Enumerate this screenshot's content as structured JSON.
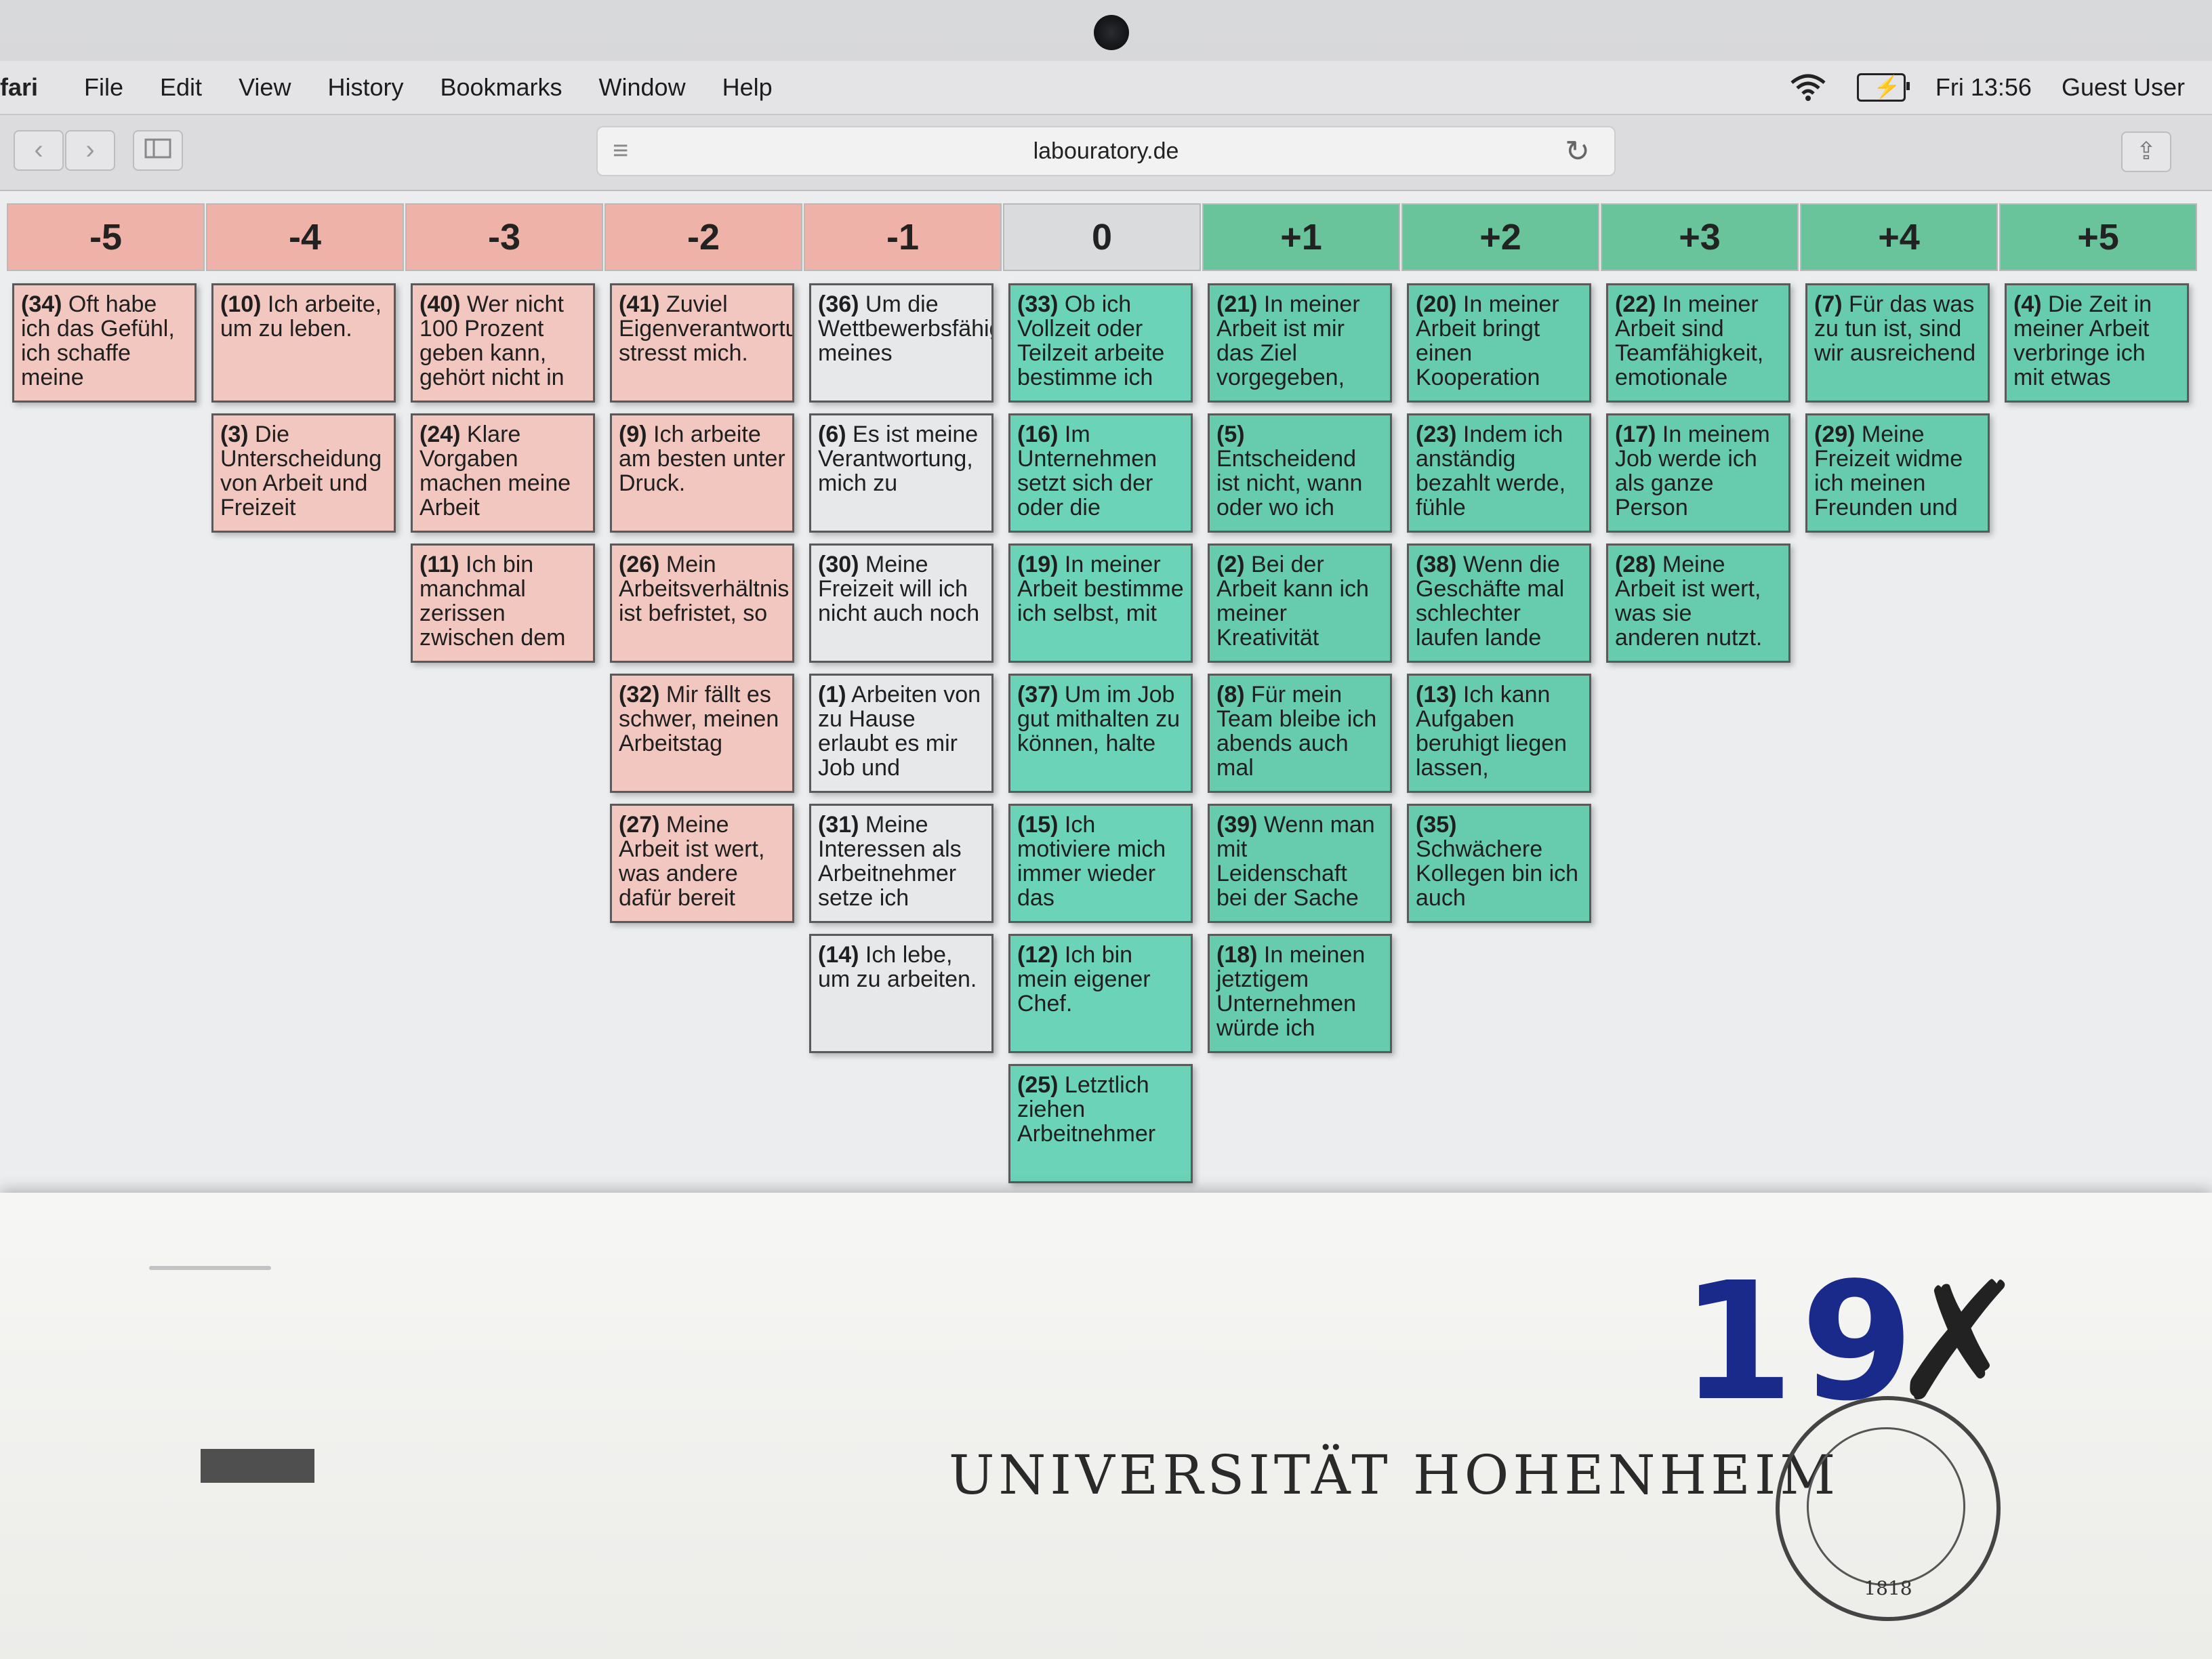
{
  "menubar": {
    "app": "fari",
    "items": [
      "File",
      "Edit",
      "View",
      "History",
      "Bookmarks",
      "Window",
      "Help"
    ],
    "clock": "Fri 13:56",
    "user": "Guest User"
  },
  "browser": {
    "url": "labouratory.de"
  },
  "board": {
    "headers": [
      "-5",
      "-4",
      "-3",
      "-2",
      "-1",
      "0",
      "+1",
      "+2",
      "+3",
      "+4",
      "+5"
    ],
    "columns": [
      [
        {
          "num": "(34)",
          "text": "Oft habe ich das Gefühl, ich schaffe meine"
        }
      ],
      [
        {
          "num": "(10)",
          "text": "Ich arbeite, um zu leben."
        },
        {
          "num": "(3)",
          "text": "Die Unterscheidung von Arbeit und Freizeit"
        }
      ],
      [
        {
          "num": "(40)",
          "text": "Wer nicht 100 Prozent geben kann, gehört nicht in"
        },
        {
          "num": "(24)",
          "text": "Klare Vorgaben machen meine Arbeit"
        },
        {
          "num": "(11)",
          "text": "Ich bin manchmal zerissen zwischen dem"
        }
      ],
      [
        {
          "num": "(41)",
          "text": "Zuviel Eigenverantwortung stresst mich."
        },
        {
          "num": "(9)",
          "text": "Ich arbeite am besten unter Druck."
        },
        {
          "num": "(26)",
          "text": "Mein Arbeitsverhältnis ist befristet, so"
        },
        {
          "num": "(32)",
          "text": "Mir fällt es schwer, meinen Arbeitstag"
        },
        {
          "num": "(27)",
          "text": "Meine Arbeit ist wert, was andere dafür bereit"
        }
      ],
      [
        {
          "num": "(36)",
          "text": "Um die Wettbewerbsfähigkeit meines"
        },
        {
          "num": "(6)",
          "text": "Es ist meine Verantwortung, mich zu"
        },
        {
          "num": "(30)",
          "text": "Meine Freizeit will ich nicht auch noch"
        },
        {
          "num": "(1)",
          "text": "Arbeiten von zu Hause erlaubt es mir Job und"
        },
        {
          "num": "(31)",
          "text": "Meine Interessen als Arbeitnehmer setze ich"
        },
        {
          "num": "(14)",
          "text": "Ich lebe, um zu arbeiten."
        }
      ],
      [
        {
          "num": "(33)",
          "text": "Ob ich Vollzeit oder Teilzeit arbeite bestimme ich"
        },
        {
          "num": "(16)",
          "text": "Im Unternehmen setzt sich der oder die"
        },
        {
          "num": "(19)",
          "text": "In meiner Arbeit bestimme ich selbst, mit"
        },
        {
          "num": "(37)",
          "text": "Um im Job gut mithalten zu können, halte"
        },
        {
          "num": "(15)",
          "text": "Ich motiviere mich immer wieder das"
        },
        {
          "num": "(12)",
          "text": "Ich bin mein eigener Chef."
        },
        {
          "num": "(25)",
          "text": "Letztlich ziehen Arbeitnehmer"
        }
      ],
      [
        {
          "num": "(21)",
          "text": "In meiner Arbeit ist mir das Ziel vorgegeben,"
        },
        {
          "num": "(5)",
          "text": "Entscheidend ist nicht, wann oder wo ich"
        },
        {
          "num": "(2)",
          "text": "Bei der Arbeit kann ich meiner Kreativität"
        },
        {
          "num": "(8)",
          "text": "Für mein Team bleibe ich abends auch mal"
        },
        {
          "num": "(39)",
          "text": "Wenn man mit Leidenschaft bei der Sache"
        },
        {
          "num": "(18)",
          "text": "In meinen jetztigem Unternehmen würde ich"
        }
      ],
      [
        {
          "num": "(20)",
          "text": "In meiner Arbeit bringt einen Kooperation"
        },
        {
          "num": "(23)",
          "text": "Indem ich anständig bezahlt werde, fühle"
        },
        {
          "num": "(38)",
          "text": "Wenn die Geschäfte mal schlechter laufen lande"
        },
        {
          "num": "(13)",
          "text": "Ich kann Aufgaben beruhigt liegen lassen,"
        },
        {
          "num": "(35)",
          "text": "Schwächere Kollegen bin ich auch"
        }
      ],
      [
        {
          "num": "(22)",
          "text": "In meiner Arbeit sind Teamfähigkeit, emotionale"
        },
        {
          "num": "(17)",
          "text": "In meinem Job werde ich als ganze Person"
        },
        {
          "num": "(28)",
          "text": "Meine Arbeit ist wert, was sie anderen nutzt."
        }
      ],
      [
        {
          "num": "(7)",
          "text": "Für das was zu tun ist, sind wir ausreichend"
        },
        {
          "num": "(29)",
          "text": "Meine Freizeit widme ich meinen Freunden und"
        }
      ],
      [
        {
          "num": "(4)",
          "text": "Die Zeit in meiner Arbeit verbringe ich mit etwas"
        }
      ]
    ]
  },
  "paper": {
    "university": "UNIVERSITÄT HOHENHEIM",
    "handwritten_number": "19",
    "seal_year": "1818"
  }
}
